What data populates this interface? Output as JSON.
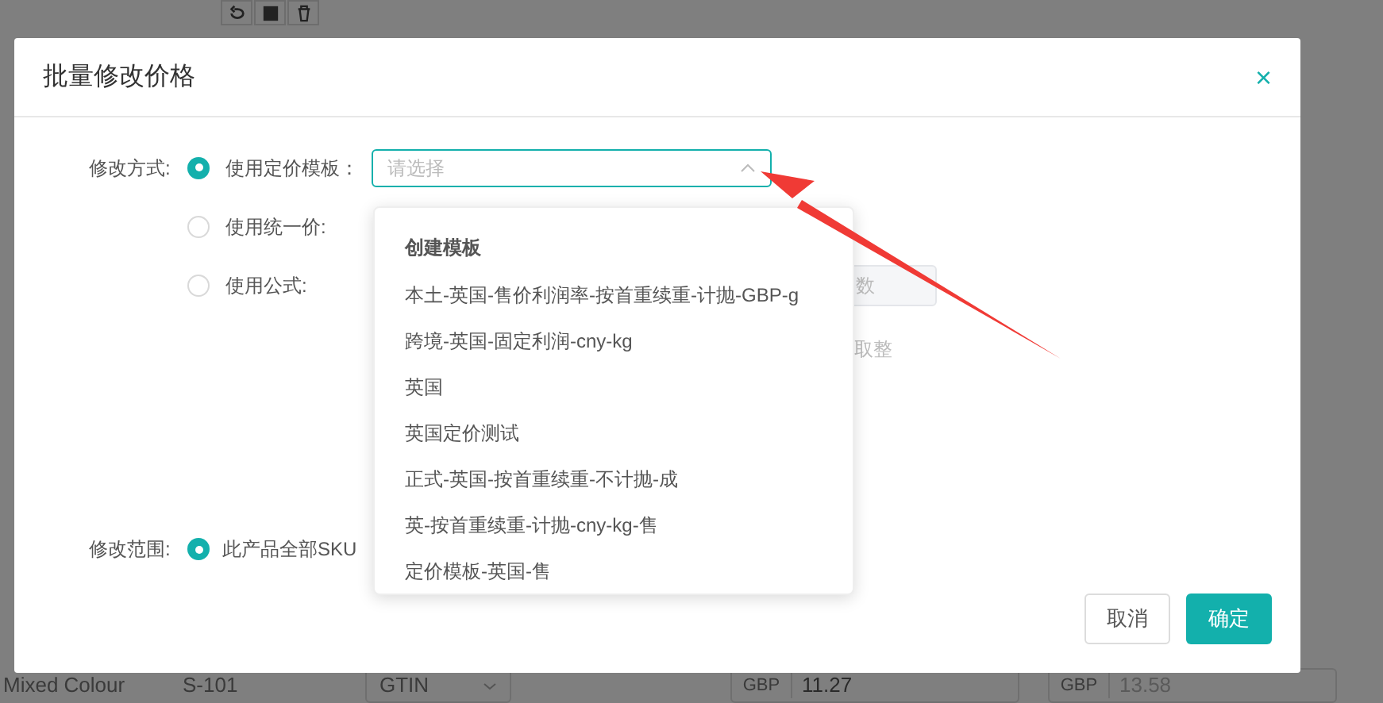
{
  "background": {
    "bottom_row": {
      "color_name": "Mixed Colour",
      "sku": "S-101",
      "code_type": "GTIN",
      "prices": [
        {
          "currency": "GBP",
          "value": "11.27"
        },
        {
          "currency": "GBP",
          "value": "13.58"
        }
      ]
    }
  },
  "dialog": {
    "title": "批量修改价格",
    "close": "×",
    "method_label": "修改方式:",
    "methods": [
      {
        "label": "使用定价模板：",
        "selected": true,
        "kind": "template"
      },
      {
        "label": "使用统一价:",
        "selected": false,
        "kind": "plain"
      },
      {
        "label": "使用公式:",
        "selected": false,
        "kind": "plain"
      }
    ],
    "template_select": {
      "placeholder": "请选择",
      "expanded": true
    },
    "hidden_fragments": {
      "field_text": "数",
      "rounding_text": "取整"
    },
    "dropdown": {
      "header": "创建模板",
      "options": [
        "本土-英国-售价利润率-按首重续重-计抛-GBP-g",
        "跨境-英国-固定利润-cny-kg",
        "英国",
        "英国定价测试",
        "正式-英国-按首重续重-不计抛-成",
        "英-按首重续重-计抛-cny-kg-售",
        "定价模板-英国-售"
      ]
    },
    "scope_label": "修改范围:",
    "scopes": [
      {
        "label": "此产品全部SKU",
        "selected": true
      }
    ],
    "buttons": [
      {
        "label": "取消",
        "kind": "secondary"
      },
      {
        "label": "确定",
        "kind": "primary"
      }
    ]
  }
}
